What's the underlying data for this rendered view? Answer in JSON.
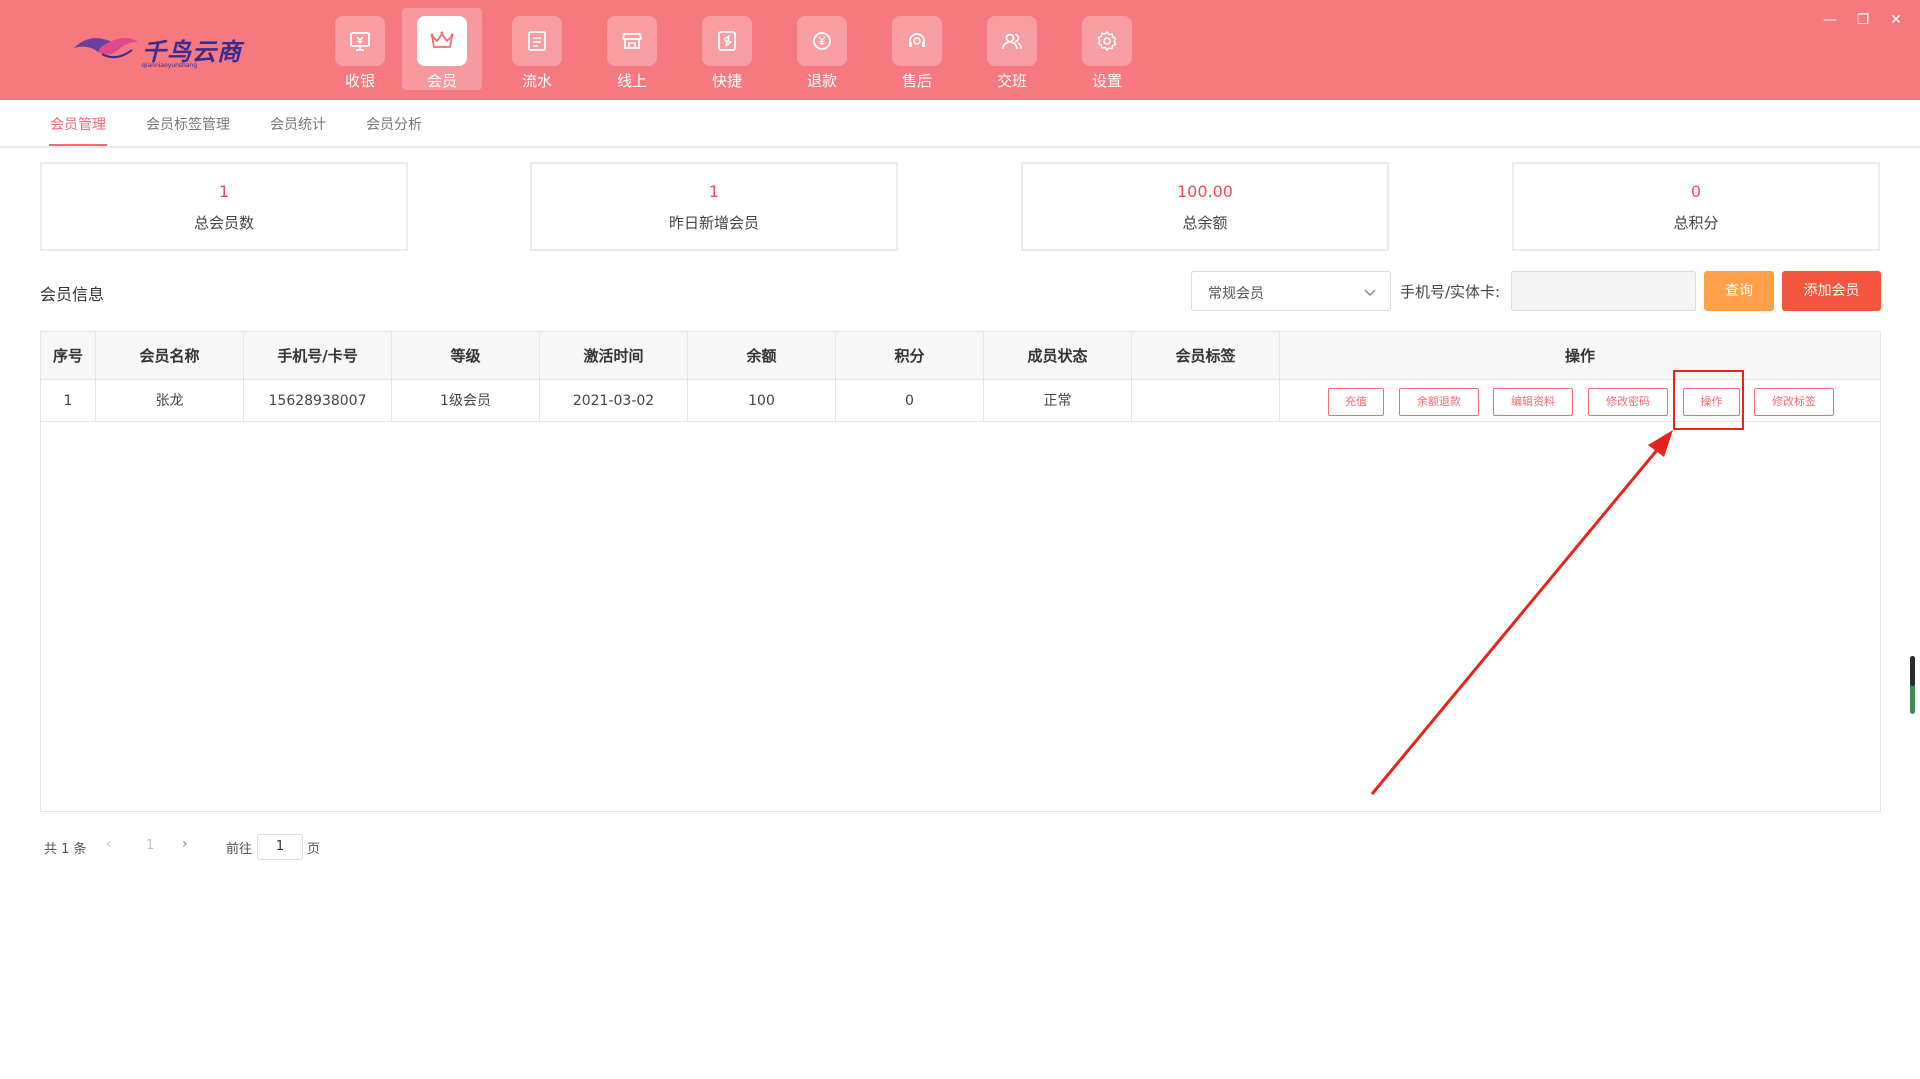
{
  "app": {
    "logo_text": "千鸟云商",
    "logo_sub": "qianniaoyunshang"
  },
  "nav": {
    "items": [
      {
        "label": "收银",
        "icon": "cashier-monitor-icon"
      },
      {
        "label": "会员",
        "icon": "crown-icon",
        "active": true
      },
      {
        "label": "流水",
        "icon": "ledger-icon"
      },
      {
        "label": "线上",
        "icon": "store-icon"
      },
      {
        "label": "快捷",
        "icon": "shortcut-icon"
      },
      {
        "label": "退款",
        "icon": "refund-icon"
      },
      {
        "label": "售后",
        "icon": "headset-icon"
      },
      {
        "label": "交班",
        "icon": "users-icon"
      },
      {
        "label": "设置",
        "icon": "gear-icon"
      }
    ]
  },
  "window_controls": {
    "minimize": "—",
    "restore": "❐",
    "close": "✕"
  },
  "subtabs": [
    {
      "label": "会员管理",
      "active": true
    },
    {
      "label": "会员标签管理"
    },
    {
      "label": "会员统计"
    },
    {
      "label": "会员分析"
    }
  ],
  "stats": [
    {
      "value": "1",
      "label": "总会员数"
    },
    {
      "value": "1",
      "label": "昨日新增会员"
    },
    {
      "value": "100.00",
      "label": "总余额"
    },
    {
      "value": "0",
      "label": "总积分"
    }
  ],
  "toolbar": {
    "section_title": "会员信息",
    "member_type_selected": "常规会员",
    "search_label": "手机号/实体卡:",
    "search_value": "",
    "query_label": "查询",
    "add_label": "添加会员"
  },
  "table": {
    "headers": [
      "序号",
      "会员名称",
      "手机号/卡号",
      "等级",
      "激活时间",
      "余额",
      "积分",
      "成员状态",
      "会员标签",
      "操作"
    ],
    "rows": [
      {
        "index": "1",
        "name": "张龙",
        "phone": "15628938007",
        "level": "1级会员",
        "activated": "2021-03-02",
        "balance": "100",
        "points": "0",
        "status": "正常",
        "tag": "",
        "actions": [
          "充值",
          "余额退款",
          "编辑资料",
          "修改密码",
          "操作",
          "修改标签"
        ]
      }
    ]
  },
  "pagination": {
    "total_text": "共 1 条",
    "prev": "‹",
    "current_page": "1",
    "next": "›",
    "goto_label": "前往",
    "goto_value": "1",
    "page_unit": "页"
  },
  "colors": {
    "header_bg": "#f5797f",
    "accent": "#f36b75",
    "stat_value": "#f04b5a",
    "query_btn": "#ff9f4a",
    "add_btn": "#f5553e",
    "annotation_red": "#e8231c"
  }
}
